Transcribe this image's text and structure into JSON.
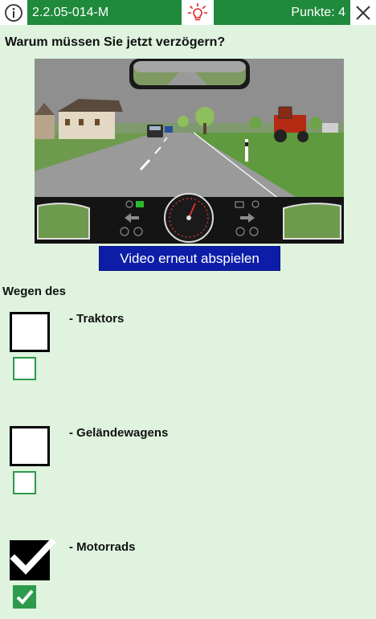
{
  "header": {
    "question_code": "2.2.05-014-M",
    "points_label": "Punkte: 4",
    "icons": [
      "info-icon",
      "lightbulb-icon",
      "close-icon"
    ]
  },
  "question": {
    "text": "Warum müssen Sie jetzt verzögern?",
    "replay_label": "Video erneut abspielen",
    "intro": "Wegen des"
  },
  "answers": [
    {
      "label": "- Traktors",
      "checked": false,
      "solution": false
    },
    {
      "label": "- Geländewagens",
      "checked": false,
      "solution": false
    },
    {
      "label": "- Motorrads",
      "checked": true,
      "solution": true
    }
  ],
  "colors": {
    "green": "#1f8a3b",
    "background": "#dff3df",
    "button_blue": "#0d1da8",
    "hint_red": "#e02020"
  }
}
